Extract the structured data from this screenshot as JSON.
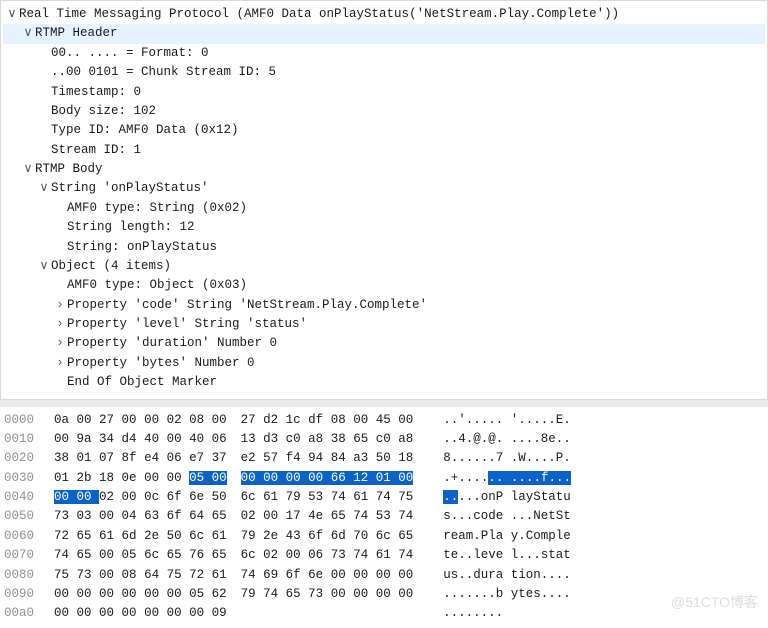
{
  "tree": {
    "root": {
      "label": "Real Time Messaging Protocol (AMF0 Data onPlayStatus('NetStream.Play.Complete'))",
      "expanded": true
    },
    "header": {
      "label": "RTMP Header",
      "expanded": true,
      "lines": [
        "00.. .... = Format: 0",
        "..00 0101 = Chunk Stream ID: 5",
        "Timestamp: 0",
        "Body size: 102",
        "Type ID: AMF0 Data (0x12)",
        "Stream ID: 1"
      ]
    },
    "body": {
      "label": "RTMP Body",
      "expanded": true,
      "string_item": {
        "label": "String 'onPlayStatus'",
        "expanded": true,
        "lines": [
          "AMF0 type: String (0x02)",
          "String length: 12",
          "String: onPlayStatus"
        ]
      },
      "object_item": {
        "label": "Object (4 items)",
        "expanded": true,
        "amf_line": "AMF0 type: Object (0x03)",
        "props": [
          "Property 'code' String 'NetStream.Play.Complete'",
          "Property 'level' String 'status'",
          "Property 'duration' Number 0",
          "Property 'bytes' Number 0"
        ],
        "end": "End Of Object Marker"
      }
    }
  },
  "hex": {
    "selection": {
      "from": {
        "row": 3,
        "col": 6
      },
      "to": {
        "row": 4,
        "col": 1
      }
    },
    "rows": [
      {
        "offset": "0000",
        "l": "0a 00 27 00 00 02 08 00",
        "r": "27 d2 1c df 08 00 45 00",
        "la": "..'..... ",
        "ra": "'.....E."
      },
      {
        "offset": "0010",
        "l": "00 9a 34 d4 40 00 40 06",
        "r": "13 d3 c0 a8 38 65 c0 a8",
        "la": "..4.@.@. ",
        "ra": "....8e.."
      },
      {
        "offset": "0020",
        "l": "38 01 07 8f e4 06 e7 37",
        "r": "e2 57 f4 94 84 a3 50 18",
        "la": "8......7 ",
        "ra": ".W....P."
      },
      {
        "offset": "0030",
        "l": "01 2b 18 0e 00 00 05 00",
        "r": "00 00 00 00 66 12 01 00",
        "la": ".+...... ",
        "ra": "....f..."
      },
      {
        "offset": "0040",
        "l": "00 00 02 00 0c 6f 6e 50",
        "r": "6c 61 79 53 74 61 74 75",
        "la": ".....onP ",
        "ra": "layStatu"
      },
      {
        "offset": "0050",
        "l": "73 03 00 04 63 6f 64 65",
        "r": "02 00 17 4e 65 74 53 74",
        "la": "s...code ",
        "ra": "...NetSt"
      },
      {
        "offset": "0060",
        "l": "72 65 61 6d 2e 50 6c 61",
        "r": "79 2e 43 6f 6d 70 6c 65",
        "la": "ream.Pla ",
        "ra": "y.Comple"
      },
      {
        "offset": "0070",
        "l": "74 65 00 05 6c 65 76 65",
        "r": "6c 02 00 06 73 74 61 74",
        "la": "te..leve ",
        "ra": "l...stat"
      },
      {
        "offset": "0080",
        "l": "75 73 00 08 64 75 72 61",
        "r": "74 69 6f 6e 00 00 00 00",
        "la": "us..dura ",
        "ra": "tion...."
      },
      {
        "offset": "0090",
        "l": "00 00 00 00 00 00 05 62",
        "r": "79 74 65 73 00 00 00 00",
        "la": ".......b ",
        "ra": "ytes...."
      },
      {
        "offset": "00a0",
        "l": "00 00 00 00 00 00 00 09",
        "r": "",
        "la": "........ ",
        "ra": ""
      }
    ]
  },
  "watermark": "@51CTO博客"
}
